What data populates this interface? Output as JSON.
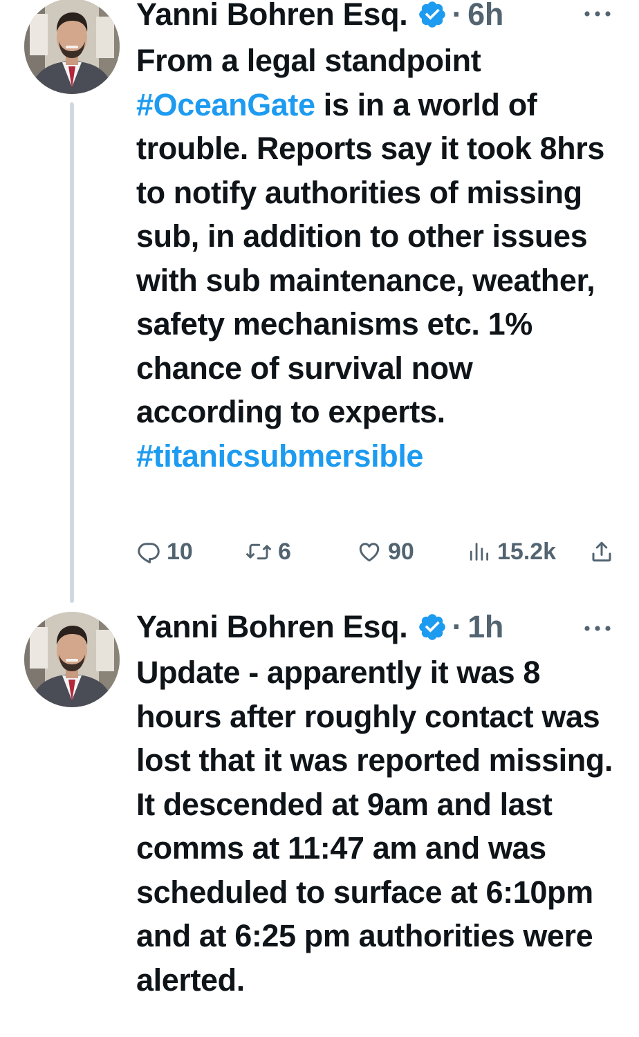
{
  "thread": [
    {
      "author_name": "Yanni Bohren Esq.",
      "time": "6h",
      "text_segments": [
        {
          "text": "From a legal standpoint ",
          "type": "text"
        },
        {
          "text": "#OceanGate",
          "type": "hashtag"
        },
        {
          "text": " is in a world of trouble. Reports say it took 8hrs to notify authorities of missing sub, in addition to other issues with sub maintenance, weather, safety mechanisms etc. 1% chance of survival now according to experts. ",
          "type": "text"
        },
        {
          "text": "#titanicsubmersible",
          "type": "hashtag"
        }
      ],
      "stats": {
        "replies": "10",
        "retweets": "6",
        "likes": "90",
        "views": "15.2k"
      }
    },
    {
      "author_name": "Yanni Bohren Esq.",
      "time": "1h",
      "text_segments": [
        {
          "text": "Update - apparently it was 8 hours after roughly contact was lost that it was reported missing. It descended at 9am and last comms at 11:47 am and was scheduled to surface at 6:10pm and at 6:25 pm authorities were alerted.",
          "type": "text"
        }
      ]
    }
  ],
  "separator": "·",
  "colors": {
    "text": "#0f1419",
    "secondary": "#536471",
    "accent": "#1d9bf0",
    "thread_line": "#cfd9de"
  },
  "icons": {
    "verified": "verified-badge-icon",
    "more": "more-horizontal-icon",
    "reply": "reply-icon",
    "retweet": "retweet-icon",
    "like": "heart-icon",
    "views": "views-chart-icon",
    "share": "share-icon"
  }
}
